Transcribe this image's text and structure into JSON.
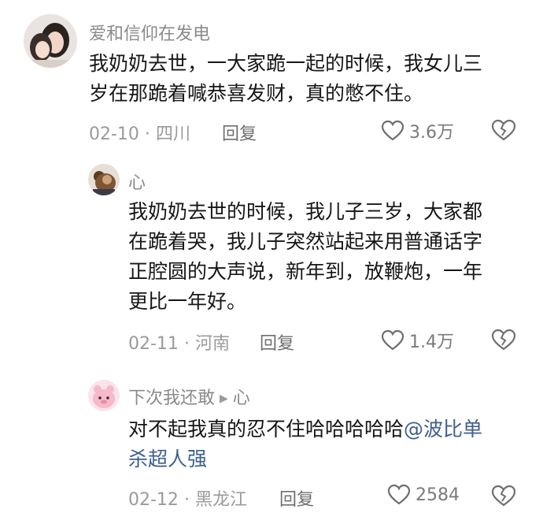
{
  "comments": [
    {
      "username": "爱和信仰在发电",
      "lines": [
        "我奶奶去世，一大家跪一起的时候，我女儿三",
        "岁在那跪着喊恭喜发财，真的憋不住。"
      ],
      "date": "02-10",
      "location": "四川",
      "reply_label": "回复",
      "likes": "3.6万"
    },
    {
      "username": "心",
      "lines": [
        "我奶奶去世的时候，我儿子三岁，大家都",
        "在跪着哭，我儿子突然站起来用普通话字",
        "正腔圆的大声说，新年到，放鞭炮，一年",
        "更比一年好。"
      ],
      "date": "02-11",
      "location": "河南",
      "reply_label": "回复",
      "likes": "1.4万"
    },
    {
      "username": "下次我还敢",
      "reply_to": "心",
      "line1": "对不起我真的忍不住哈哈哈哈哈",
      "mention1": "@波比单",
      "mention2": "杀超人强",
      "date": "02-12",
      "location": "黑龙江",
      "reply_label": "回复",
      "likes": "2584"
    }
  ],
  "colors": {
    "mention": "#3e5f8f",
    "meta": "#9a9a9a",
    "username": "#8a8a8a"
  }
}
